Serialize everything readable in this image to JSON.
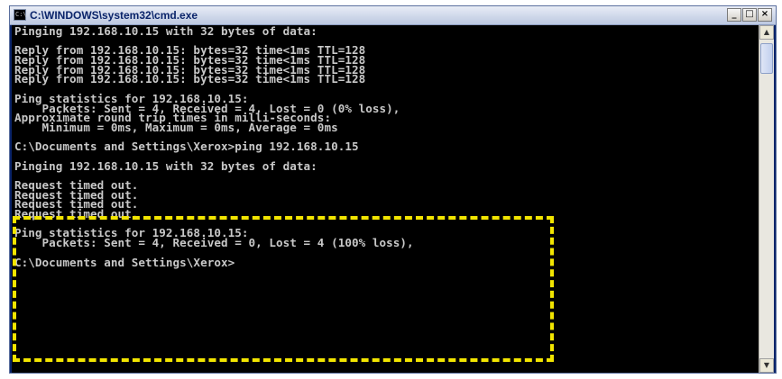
{
  "window": {
    "title": "C:\\WINDOWS\\system32\\cmd.exe",
    "icon_label": "C:\\",
    "buttons": {
      "minimize": "_",
      "maximize": "□",
      "close": "×"
    }
  },
  "console": {
    "lines": [
      "Pinging 192.168.10.15 with 32 bytes of data:",
      "",
      "Reply from 192.168.10.15: bytes=32 time<1ms TTL=128",
      "Reply from 192.168.10.15: bytes=32 time<1ms TTL=128",
      "Reply from 192.168.10.15: bytes=32 time<1ms TTL=128",
      "Reply from 192.168.10.15: bytes=32 time<1ms TTL=128",
      "",
      "Ping statistics for 192.168.10.15:",
      "    Packets: Sent = 4, Received = 4, Lost = 0 (0% loss),",
      "Approximate round trip times in milli-seconds:",
      "    Minimum = 0ms, Maximum = 0ms, Average = 0ms",
      "",
      "C:\\Documents and Settings\\Xerox>ping 192.168.10.15",
      "",
      "Pinging 192.168.10.15 with 32 bytes of data:",
      "",
      "Request timed out.",
      "Request timed out.",
      "Request timed out.",
      "Request timed out.",
      "",
      "Ping statistics for 192.168.10.15:",
      "    Packets: Sent = 4, Received = 0, Lost = 4 (100% loss),",
      "",
      "C:\\Documents and Settings\\Xerox>"
    ]
  },
  "scrollbar": {
    "up_arrow": "▲",
    "down_arrow": "▼"
  },
  "colors": {
    "console_bg": "#000000",
    "console_text": "#c8c8c8",
    "highlight": "#f2e500"
  }
}
